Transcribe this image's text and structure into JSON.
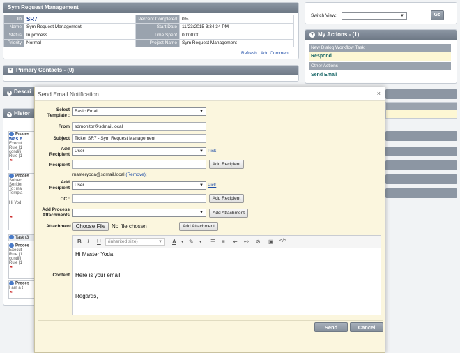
{
  "request_panel": {
    "title": "Sym Request Management",
    "id_label": "ID",
    "id_value": "SR7",
    "name_label": "Name",
    "name_value": "Sym Request Management",
    "status_label": "Status",
    "status_value": "In process",
    "priority_label": "Priority",
    "priority_value": "Normal",
    "percent_label": "Percent Completed",
    "percent_value": "0%",
    "start_label": "Start Date",
    "start_value": "11/23/2015 3:34:34 PM",
    "time_label": "Time Spent",
    "time_value": "00:00:00",
    "project_label": "Project Name",
    "project_value": "Sym Request Management",
    "refresh": "Refresh",
    "add_comment": "Add Comment"
  },
  "primary_contacts": {
    "title": "Primary Contacts - (0)"
  },
  "background_stubs": {
    "desc": "Descri",
    "history": "Histor",
    "task": "Task (3"
  },
  "history_items": [
    {
      "title": "Proces",
      "sub": "was e",
      "lines": [
        "Execut",
        "Rule [1",
        "conditi",
        "Rule [1"
      ]
    },
    {
      "title": "Proces",
      "sub": "",
      "lines": [
        "Subjec",
        "Sender",
        "To: ma",
        "Templa",
        "",
        "Hi Yod"
      ]
    },
    {
      "title": "Proces",
      "sub": "",
      "lines": [
        "Execut",
        "Rule [1",
        "conditi",
        "Rule [1"
      ]
    },
    {
      "title": "Proces",
      "sub": "",
      "lines": [
        "I am a t"
      ]
    }
  ],
  "right_panel": {
    "switch_view_label": "Switch View:",
    "switch_view_value": "",
    "go": "Go",
    "my_actions_title": "My Actions - (1)",
    "new_task_header": "New Dialog Workflow Task",
    "respond": "Respond",
    "other_actions_header": "Other Actions",
    "send_email": "Send Email"
  },
  "dialog": {
    "title": "Send Email Notification",
    "close": "×",
    "select_template_label": "Select Template :",
    "template_value": "Basic Email",
    "from_label": "From",
    "from_value": "sdmonitor@sdmail.local",
    "subject_label": "Subject",
    "subject_value": "Ticket SR7 - Sym Request Management",
    "add_recipient_label": "Add Recipient",
    "recipient_type": "User",
    "pick": "Pick",
    "recipient_label": "Recipient",
    "add_recipient_btn": "Add Recipient",
    "recipient_email": "masteryoda@sdmail.local",
    "remove": "(Remove)",
    "add_recipient_label2": "Add Recipient",
    "recipient_type2": "User",
    "pick2": "Pick",
    "cc_label": "CC :",
    "add_recipient_btn2": "Add Recipient",
    "process_attach_label": "Add Process Attachments",
    "add_attachment_btn": "Add Attachment",
    "attachment_label": "Attachment",
    "choose_file": "Choose File",
    "no_file": "No file chosen",
    "add_attachment_btn2": "Add Attachment",
    "content_label": "Content",
    "font_size_placeholder": "(inherited size)",
    "content_lines": [
      "Hi Master Yoda,",
      "",
      "",
      "Here is your email.",
      "",
      "",
      "Regards,"
    ],
    "send": "Send",
    "cancel": "Cancel"
  }
}
